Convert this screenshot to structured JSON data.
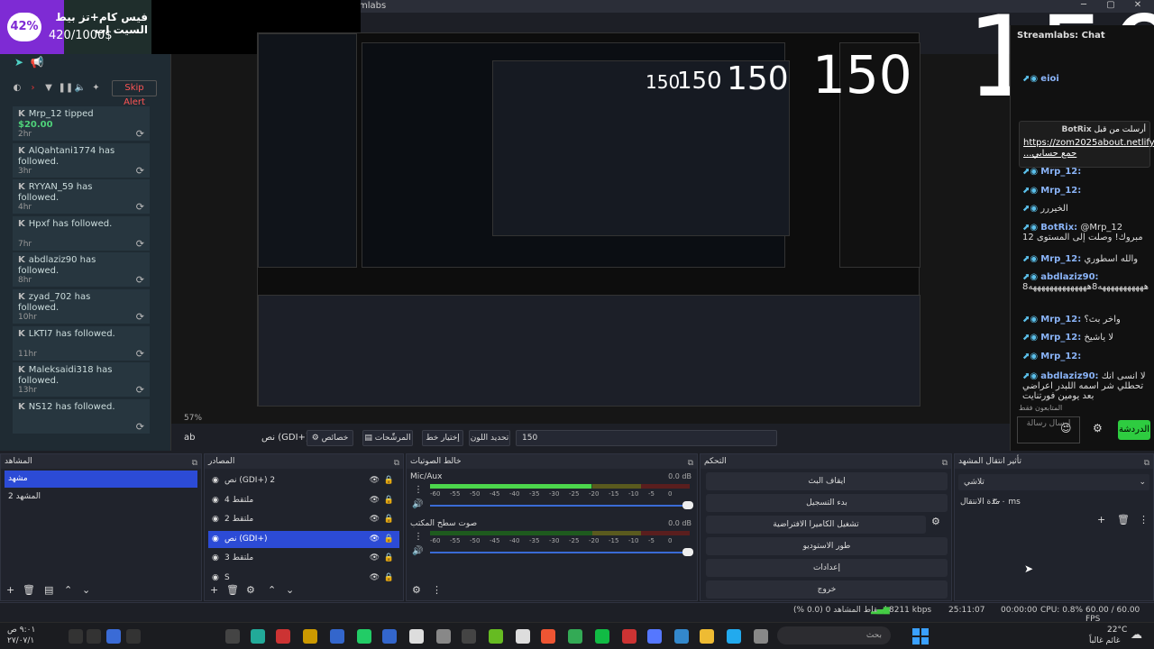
{
  "window": {
    "title": "mlabs"
  },
  "goal": {
    "title": "فيس كام+تز بيط السيت اب",
    "value": "420/1000$",
    "percent_label": "42%",
    "percent": 0.42
  },
  "alerts": {
    "skip_label": "Skip Alert",
    "items": [
      {
        "user": "Mrp_12",
        "text": " tipped ",
        "amount": "$20.00",
        "time": "2hr"
      },
      {
        "user": "AlQahtani1774",
        "text": " has followed.",
        "time": "3hr"
      },
      {
        "user": "RYYAN_59",
        "text": " has followed.",
        "time": "4hr"
      },
      {
        "user": "Hpxf",
        "text": " has followed.",
        "time": "7hr"
      },
      {
        "user": "abdlaziz90",
        "text": " has followed.",
        "time": "8hr"
      },
      {
        "user": "zyad_702",
        "text": " has followed.",
        "time": "10hr"
      },
      {
        "user": "LKTI7",
        "text": " has followed.",
        "time": "11hr"
      },
      {
        "user": "Maleksaidi318",
        "text": " has followed.",
        "time": "13hr"
      },
      {
        "user": "NS12",
        "text": " has followed.",
        "time": ""
      }
    ]
  },
  "preview": {
    "big_number": "150",
    "zoom": "57%",
    "nest_label": "150"
  },
  "chat": {
    "title": "Streamlabs: Chat",
    "pinned": {
      "user": "BotRix",
      "prefix": "أرسلت من قبل",
      "link": "https://zom2025about.netlify.app/ ...جمع حسابي"
    },
    "messages": [
      {
        "user": "eioi",
        "text": ""
      },
      {
        "user": "Mrp_12:",
        "text": ""
      },
      {
        "user": "Mrp_12:",
        "text": ""
      },
      {
        "user": "",
        "text": "الخيررر"
      },
      {
        "user": "BotRix:",
        "text": "@Mrp_12 مبروك! وصلت إلى المستوى 12"
      },
      {
        "user": "Mrp_12:",
        "text": "والله اسطوري"
      },
      {
        "user": "abdlaziz90:",
        "text": "8هههههههههههه8ههههههههههههههه"
      },
      {
        "user": "Mrp_12:",
        "text": "واخر بث؟"
      },
      {
        "user": "Mrp_12:",
        "text": "لا ياشيخ"
      },
      {
        "user": "Mrp_12:",
        "text": ""
      },
      {
        "user": "abdlaziz90:",
        "text": "لا انسى انك تحطلي شر اسمه اللبدر اعراضي بعد يومين فورتنايت"
      }
    ],
    "followers_only": "المتابعون فقط",
    "input_placeholder": "إرسال رسالة",
    "send_label": "الدردشة"
  },
  "context_bar": {
    "source_name": "ab",
    "text_source": "نص (GDI+)",
    "properties": "خصائص",
    "filters": "المرشّحات",
    "font": "إختيار خط",
    "color": "تحديد اللون",
    "value": "150"
  },
  "docks": {
    "scenes": {
      "title": "المشاهد",
      "items": [
        "مشهد",
        "المشهد 2"
      ]
    },
    "sources": {
      "title": "المصادر",
      "items": [
        "نص (GDI+) 2",
        "ملتقط 4",
        "ملتقط 2",
        "نص (GDI+)",
        "ملتقط 3",
        "S"
      ]
    },
    "mixer": {
      "title": "خالط الصوتيات",
      "channels": [
        {
          "name": "Mic/Aux",
          "db": "0.0 dB",
          "level": 0.82
        },
        {
          "name": "صوت سطح المكتب",
          "db": "0.0 dB",
          "level": 0.0
        }
      ],
      "scale": [
        "-60",
        "-55",
        "-50",
        "-45",
        "-40",
        "-35",
        "-30",
        "-25",
        "-20",
        "-15",
        "-10",
        "-5",
        "0"
      ]
    },
    "controls": {
      "title": "التحكم",
      "buttons": [
        "ايقاف البث",
        "بدء التسجيل",
        "تشغيل الكاميرا الافتراضية",
        "طور الاستوديو",
        "إعدادات",
        "خروج"
      ]
    },
    "transitions": {
      "title": "تأثير انتقال المشهد",
      "type": "تلاشي",
      "duration_label": "مدة الانتقال",
      "duration": "٣٠٠ ms"
    }
  },
  "status": {
    "dropped": "إسقاط المشاهد 0 (0.0 %)",
    "bitrate": "8211 kbps",
    "live_time": "25:11:07",
    "rec_time": "00:00:00",
    "cpu": "CPU: 0.8%",
    "fps": "60.00 / 60.00 FPS"
  },
  "taskbar": {
    "search": "بحث",
    "weather_temp": "22°C",
    "weather_desc": "غائم غالباً",
    "clock_time": "٩:٠١ ص",
    "clock_date": "٢٧/٠٧/١"
  },
  "colors": {
    "accent": "#2c4bd6",
    "goal": "#7e2bd4",
    "send": "#2ecc40"
  }
}
